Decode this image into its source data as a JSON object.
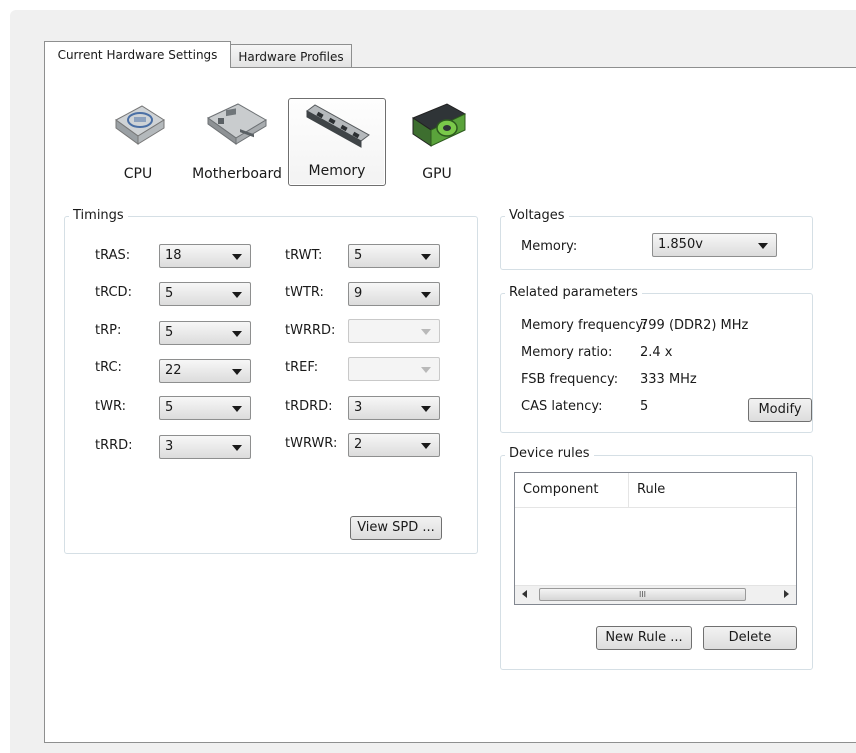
{
  "tabs": [
    {
      "label": "Current Hardware Settings",
      "active": true
    },
    {
      "label": "Hardware Profiles",
      "active": false
    }
  ],
  "categories": [
    {
      "label": "CPU",
      "icon": "cpu-chip-icon",
      "selected": false
    },
    {
      "label": "Motherboard",
      "icon": "motherboard-icon",
      "selected": false
    },
    {
      "label": "Memory",
      "icon": "memory-module-icon",
      "selected": true
    },
    {
      "label": "GPU",
      "icon": "gpu-card-icon",
      "selected": false
    }
  ],
  "timings": {
    "title": "Timings",
    "left": [
      {
        "label": "tRAS:",
        "value": "18",
        "enabled": true
      },
      {
        "label": "tRCD:",
        "value": "5",
        "enabled": true
      },
      {
        "label": "tRP:",
        "value": "5",
        "enabled": true
      },
      {
        "label": "tRC:",
        "value": "22",
        "enabled": true
      },
      {
        "label": "tWR:",
        "value": "5",
        "enabled": true
      },
      {
        "label": "tRRD:",
        "value": "3",
        "enabled": true
      }
    ],
    "right": [
      {
        "label": "tRWT:",
        "value": "5",
        "enabled": true
      },
      {
        "label": "tWTR:",
        "value": "9",
        "enabled": true
      },
      {
        "label": "tWRRD:",
        "value": "",
        "enabled": false
      },
      {
        "label": "tREF:",
        "value": "",
        "enabled": false
      },
      {
        "label": "tRDRD:",
        "value": "3",
        "enabled": true
      },
      {
        "label": "tWRWR:",
        "value": "2",
        "enabled": true
      }
    ],
    "view_spd_label": "View SPD ..."
  },
  "voltages": {
    "title": "Voltages",
    "memory_label": "Memory:",
    "memory_value": "1.850v"
  },
  "related": {
    "title": "Related parameters",
    "rows": [
      {
        "label": "Memory frequency:",
        "value": "799 (DDR2) MHz"
      },
      {
        "label": "Memory ratio:",
        "value": "2.4 x"
      },
      {
        "label": "FSB frequency:",
        "value": "333 MHz"
      },
      {
        "label": "CAS latency:",
        "value": "5"
      }
    ],
    "modify_label": "Modify"
  },
  "device_rules": {
    "title": "Device rules",
    "columns": [
      "Component",
      "Rule"
    ],
    "rows": [],
    "scroll_thumb_glyph": "III",
    "new_rule_label": "New Rule ...",
    "delete_label": "Delete"
  },
  "colors": {
    "window_bg": "#f0f0f0",
    "panel_bg": "#ffffff",
    "border": "#8e8f8f"
  }
}
